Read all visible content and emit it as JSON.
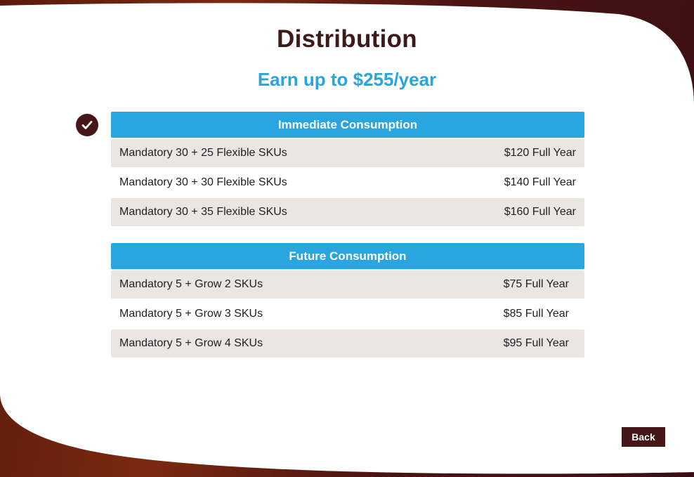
{
  "page": {
    "title": "Distribution",
    "subtitle": "Earn up to $255/year"
  },
  "sections": [
    {
      "header": "Immediate Consumption",
      "selected": true,
      "rows": [
        {
          "label": "Mandatory 30 + 25 Flexible SKUs",
          "price": "$120 Full Year"
        },
        {
          "label": "Mandatory 30 + 30 Flexible SKUs",
          "price": "$140 Full Year"
        },
        {
          "label": "Mandatory 30 + 35 Flexible SKUs",
          "price": "$160 Full Year"
        }
      ]
    },
    {
      "header": "Future Consumption",
      "selected": false,
      "rows": [
        {
          "label": "Mandatory 5 + Grow 2 SKUs",
          "price": "$75 Full Year"
        },
        {
          "label": "Mandatory 5 + Grow 3 SKUs",
          "price": "$85 Full Year"
        },
        {
          "label": "Mandatory 5 + Grow 4 SKUs",
          "price": "$95 Full Year"
        }
      ]
    }
  ],
  "buttons": {
    "back_label": "Back"
  },
  "colors": {
    "accent": "#29a6e0",
    "brand_dark": "#451716",
    "title_text": "#3d1a1a",
    "row_shade": "#ebe6e2"
  },
  "icons": {
    "selected_marker": "checkmark-icon"
  }
}
